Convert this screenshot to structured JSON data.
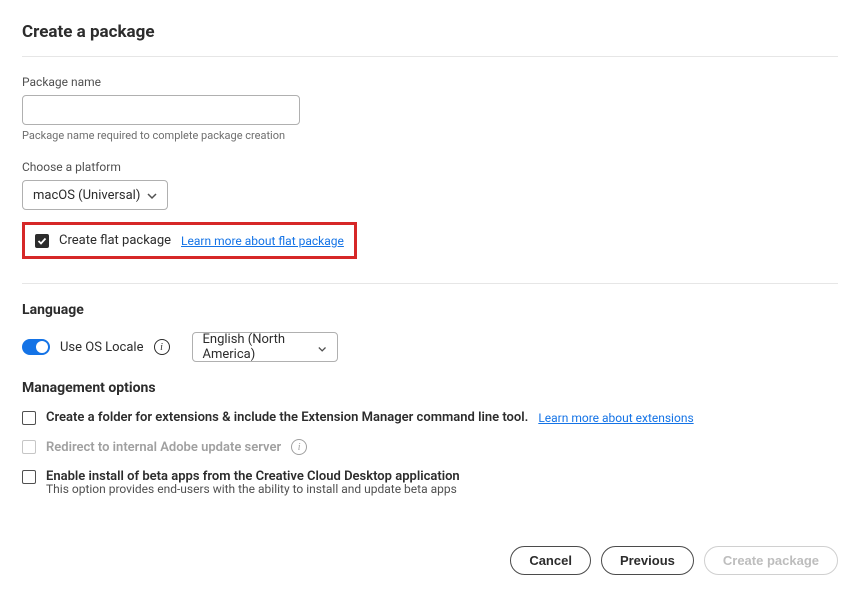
{
  "title": "Create a package",
  "package_name": {
    "label": "Package name",
    "value": "",
    "helper": "Package name required to complete package creation"
  },
  "platform": {
    "label": "Choose a platform",
    "value": "macOS (Universal)"
  },
  "flat_package": {
    "label": "Create flat package",
    "link": "Learn more about flat package",
    "checked": true
  },
  "language": {
    "heading": "Language",
    "toggle_label": "Use OS Locale",
    "value": "English (North America)"
  },
  "management": {
    "heading": "Management options",
    "ext_label": "Create a folder for extensions & include the Extension Manager command line tool.",
    "ext_link": "Learn more about extensions",
    "redirect_label": "Redirect to internal Adobe update server",
    "beta_label": "Enable install of beta apps from the Creative Cloud Desktop application",
    "beta_sub": "This option provides end-users with the ability to install and update beta apps"
  },
  "footer": {
    "cancel": "Cancel",
    "previous": "Previous",
    "create": "Create package"
  }
}
